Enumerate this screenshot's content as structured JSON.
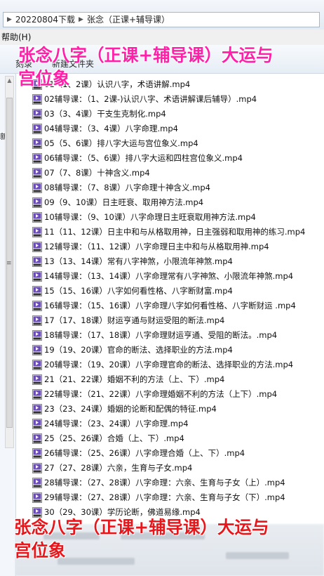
{
  "address_bar": {
    "crumbs": [
      "20220804下载",
      "张念（正课+辅导课）"
    ]
  },
  "menubar": {
    "help": "帮助(H)"
  },
  "toolbar": {
    "burn": "刻录",
    "new_folder": "新建文件夹"
  },
  "files": [
    "01（1、2课）认识八字，术语讲解.mp4",
    "02辅导课：（1、2课-)认识八字、术语讲解课后辅导）.mp4",
    "03（3、4课）干支生克制化.mp4",
    "04辅导课：（3、4课）八字命理.mp4",
    "05（5、6课）排八字大运与宫位象义.mp4",
    "06辅导课：（5、6课）排八字大运和四柱宫位象义.mp4",
    "07（7、8课）十神含义.mp4",
    "08辅导课：（7、8课）八字命理十神含义.mp4",
    "09（9、10课）日主旺衰、取用神方法.mp4",
    "10辅导课：（9、10课）八字命理日主旺衰取用神方法.mp4",
    "11（11、12课）日主中和与从格取用神，日主强弱和取用神的练习.mp4",
    "12辅导课：（11、12课）八字命理日主中和与从格取用神.mp4",
    "13（13、14课）常有八字神煞，小限流年神煞.mp4",
    "14辅导课：（13、14课）八字命理常有八字神煞、小限流年神煞.mp4",
    "15（15、16课）八字如何看性格、八字断财富.mp4",
    "16辅导课：（15、16课）八字命理八字如何看性格、八字断财运 .mp4",
    "17（17、18课）财运亨通与财运受阻的断法.mp4",
    "18辅导课：（17、18课）八字命理财运亨通、受阻的断法。.mp4",
    "19（19、20课）官命的断法、选择职业的方法.mp4",
    "20辅导课：（19、20课）八字命理官命的断法、选择职业的方法.mp4",
    "21（21、22课）婚姻不利的方法（上、下）.mp4",
    "22辅导课：（21、22课）八字命理婚姻不利的方法（上下）.mp4",
    "23（23、24课）婚姻的论断和配偶的特征.mp4",
    "24辅导课：（23、24课）八字命理.mp4",
    "25（25、26课）合婚（上、下）.mp4",
    "26辅导课：（25、26课）八字命理合婚（上、下）.mp4",
    "27（27、28课）六亲，生育与子女.mp4",
    "28辅导课：（27、28课）八字命理：六亲、生育与子女（上）.mp4",
    "29辅导课：（27、28课）八字命理：六亲、生育与子女（下）.mp4",
    "30（29、30课）学历论断，佛道易缘.mp4"
  ],
  "watermark": {
    "top_line1": "张念八字（正课+辅导课）大运与",
    "top_line2": "宫位象",
    "bottom_line1": "张念八字（正课+辅导课）大运与",
    "bottom_line2": "宫位象"
  },
  "colors": {
    "watermark_top": "#ff1fa8",
    "watermark_bottom": "#e8151b",
    "video_icon": "#6a4bb8"
  }
}
